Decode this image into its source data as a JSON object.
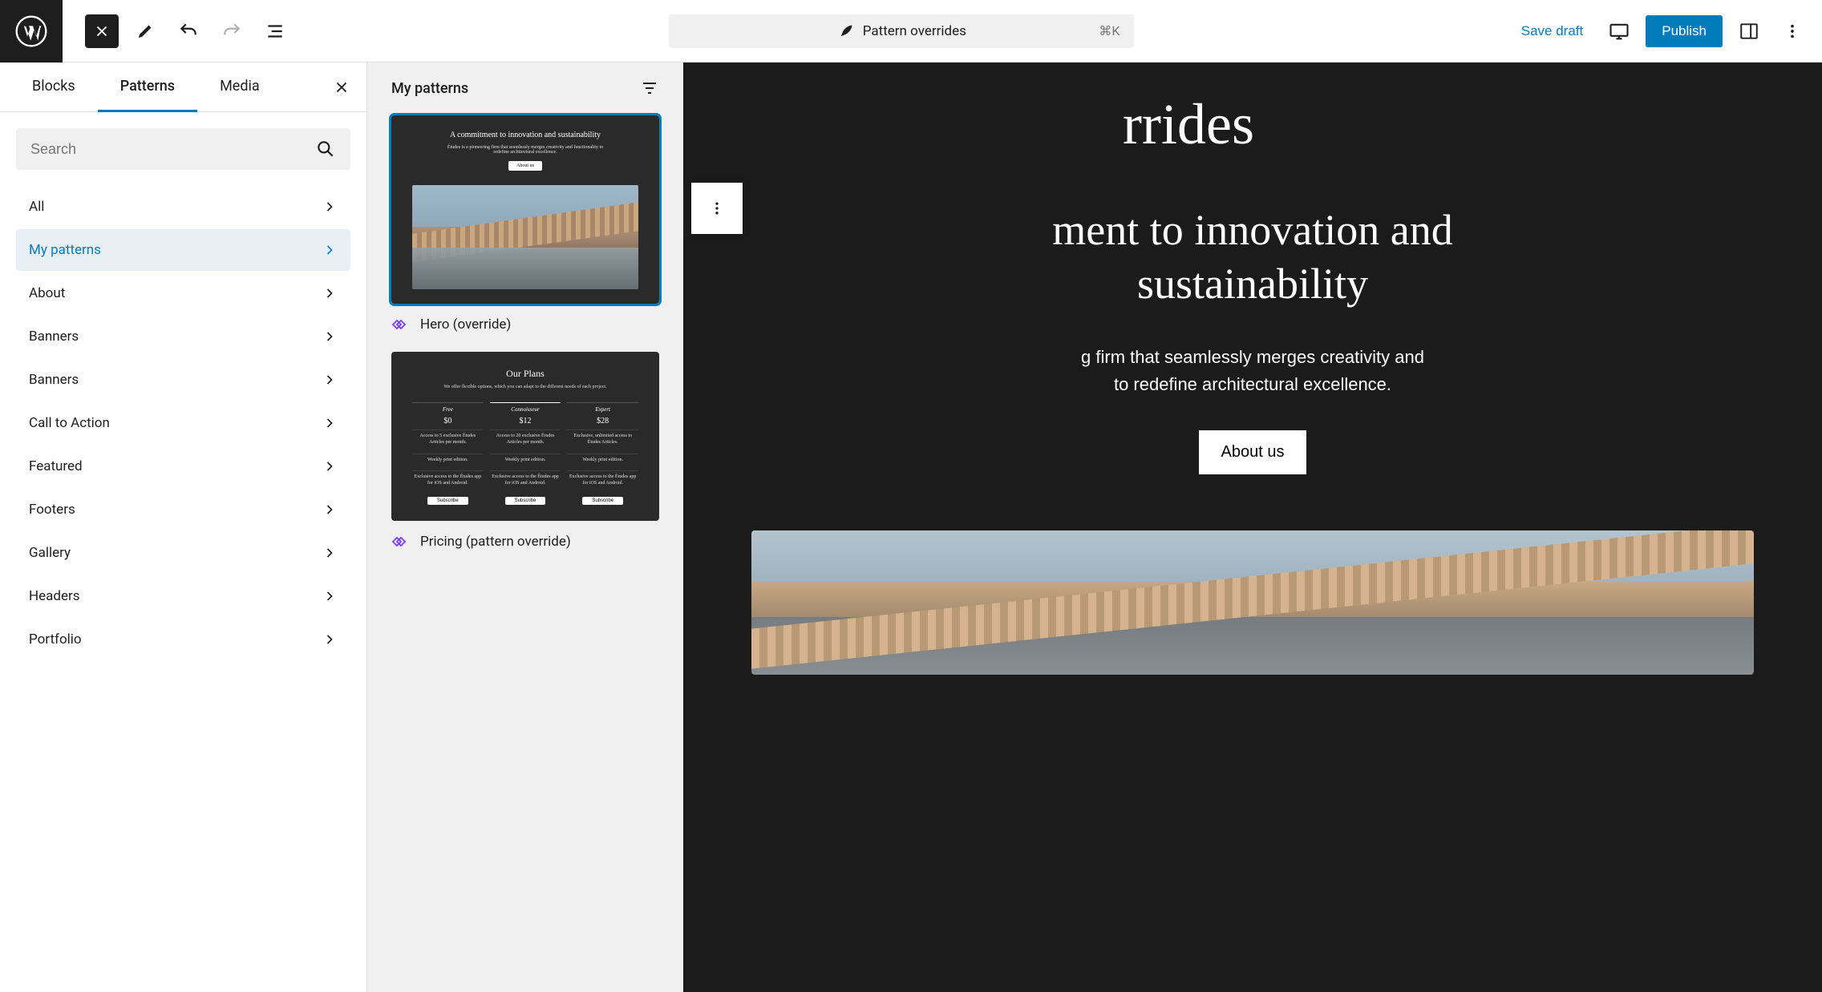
{
  "topbar": {
    "command_label": "Pattern overrides",
    "command_shortcut": "⌘K",
    "save_draft": "Save draft",
    "publish": "Publish"
  },
  "inserter": {
    "tabs": {
      "blocks": "Blocks",
      "patterns": "Patterns",
      "media": "Media"
    },
    "active_tab": "patterns",
    "search_placeholder": "Search",
    "categories": [
      {
        "label": "All",
        "active": false
      },
      {
        "label": "My patterns",
        "active": true
      },
      {
        "label": "About",
        "active": false
      },
      {
        "label": "Banners",
        "active": false
      },
      {
        "label": "Banners",
        "active": false
      },
      {
        "label": "Call to Action",
        "active": false
      },
      {
        "label": "Featured",
        "active": false
      },
      {
        "label": "Footers",
        "active": false
      },
      {
        "label": "Gallery",
        "active": false
      },
      {
        "label": "Headers",
        "active": false
      },
      {
        "label": "Portfolio",
        "active": false
      }
    ]
  },
  "patterns_panel": {
    "title": "My patterns",
    "items": [
      {
        "label": "Hero (override)",
        "selected": true,
        "preview": {
          "heading": "A commitment to innovation and sustainability",
          "sub": "Études is a pioneering firm that seamlessly merges creativity and functionality to redefine architectural excellence.",
          "button": "About us"
        }
      },
      {
        "label": "Pricing (pattern override)",
        "selected": false,
        "preview": {
          "heading": "Our Plans",
          "sub": "We offer flexible options, which you can adapt to the different needs of each project.",
          "plans": [
            {
              "name": "Free",
              "price": "$0",
              "f1": "Access to 5 exclusive Études Articles per month.",
              "f2": "Weekly print edition.",
              "f3": "Exclusive access to the Études app for iOS and Android.",
              "btn": "Subscribe"
            },
            {
              "name": "Connoisseur",
              "price": "$12",
              "f1": "Access to 20 exclusive Études Articles per month.",
              "f2": "Weekly print edition.",
              "f3": "Exclusive access to the Études app for iOS and Android.",
              "btn": "Subscribe"
            },
            {
              "name": "Expert",
              "price": "$28",
              "f1": "Exclusive, unlimited access to Études Articles.",
              "f2": "Weekly print edition.",
              "f3": "Exclusive access to the Études app for iOS and Android.",
              "btn": "Subscribe"
            }
          ]
        }
      }
    ]
  },
  "canvas": {
    "title_fragment": "rrides",
    "heading_line1": "ment to innovation and",
    "heading_line2": "sustainability",
    "paragraph_line1": "g firm that seamlessly merges creativity and",
    "paragraph_line2": "to redefine architectural excellence.",
    "cta": "About us"
  }
}
